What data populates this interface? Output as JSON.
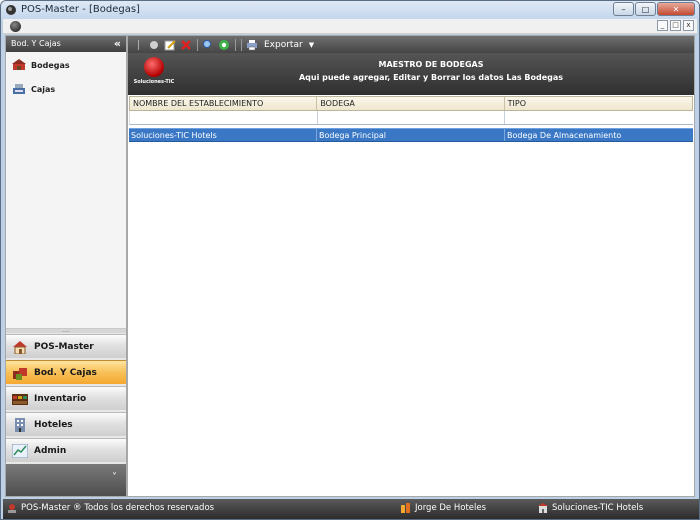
{
  "window": {
    "title": "POS-Master - [Bodegas]"
  },
  "left_panel": {
    "header": "Bod. Y Cajas",
    "collapse_glyph": "«",
    "items": [
      {
        "label": "Bodegas",
        "icon": "warehouse-icon"
      },
      {
        "label": "Cajas",
        "icon": "cash-register-icon"
      }
    ],
    "grip": "....",
    "nav": [
      {
        "label": "POS-Master",
        "icon": "home-icon",
        "active": false
      },
      {
        "label": "Bod. Y Cajas",
        "icon": "boxes-icon",
        "active": true
      },
      {
        "label": "Inventario",
        "icon": "inventory-icon",
        "active": false
      },
      {
        "label": "Hoteles",
        "icon": "building-icon",
        "active": false
      },
      {
        "label": "Admin",
        "icon": "chart-icon",
        "active": false
      }
    ],
    "footer_glyph": "˅"
  },
  "toolbar": {
    "export_label": "Exportar",
    "dropdown_glyph": "▼"
  },
  "banner": {
    "logo_text": "Soluciones-TIC",
    "title": "MAESTRO DE BODEGAS",
    "subtitle": "Aqui puede agregar, Editar y Borrar los datos Las Bodegas"
  },
  "grid": {
    "columns": [
      "NOMBRE DEL ESTABLECIMIENTO",
      "BODEGA",
      "TIPO"
    ],
    "rows": [
      {
        "establecimiento": "Soluciones-TIC Hotels",
        "bodega": "Bodega Principal",
        "tipo": "Bodega De Almacenamiento"
      }
    ]
  },
  "status_bar": {
    "app": "POS-Master ®  Todos los derechos reservados",
    "user": "Jorge   De Hoteles",
    "company": "Soluciones-TIC Hotels"
  },
  "colors": {
    "selection": "#3a78c6",
    "active_nav": "#f8c35c",
    "banner": "#3f3f3f"
  }
}
